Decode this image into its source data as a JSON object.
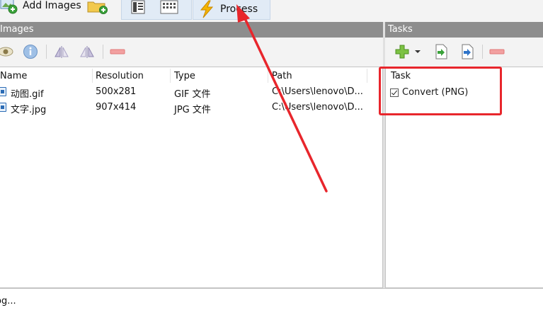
{
  "toolbar": {
    "add_images_label": "Add Images",
    "process_label": "Process"
  },
  "images_pane": {
    "header": "Images",
    "columns": [
      "Name",
      "Resolution",
      "Type",
      "Path"
    ],
    "rows": [
      {
        "name": "动图.gif",
        "resolution": "500x281",
        "type": "GIF 文件",
        "path": "C:\\Users\\lenovo\\D..."
      },
      {
        "name": "文字.jpg",
        "resolution": "907x414",
        "type": "JPG 文件",
        "path": "C:\\Users\\lenovo\\D..."
      }
    ]
  },
  "tasks_pane": {
    "header": "Tasks",
    "column": "Task",
    "items": [
      {
        "label": "Convert (PNG)",
        "checked": true
      }
    ]
  },
  "log": {
    "text": "og..."
  },
  "colors": {
    "annotation_red": "#e8262c",
    "header_gray": "#8d8d8d",
    "selected_btn_bg": "#e1ebf6"
  }
}
